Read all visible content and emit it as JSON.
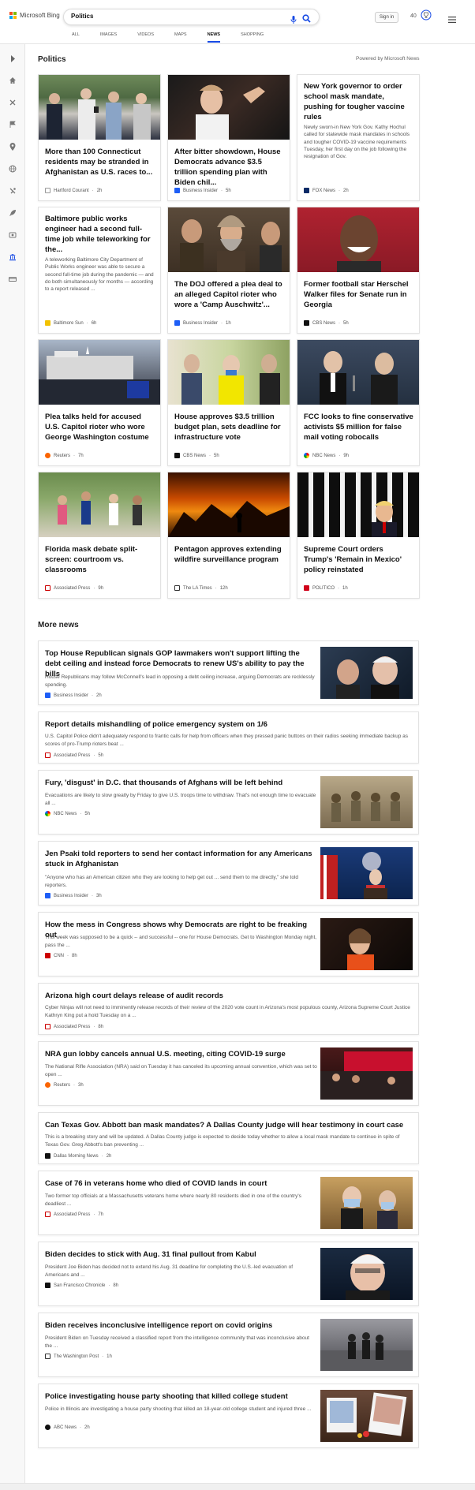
{
  "header": {
    "brand": "Microsoft Bing",
    "search_value": "Politics",
    "signin_label": "Sign in",
    "points": "40",
    "tabs": [
      "ALL",
      "IMAGES",
      "VIDEOS",
      "MAPS",
      "NEWS",
      "SHOPPING"
    ],
    "active_tab": "NEWS"
  },
  "sidebar": {
    "icons": [
      "chevron-right-icon",
      "home-icon",
      "sports-icon",
      "flag-icon",
      "location-pin-icon",
      "globe-icon",
      "science-icon",
      "rocket-icon",
      "entertainment-icon",
      "politics-icon",
      "money-icon"
    ]
  },
  "section": {
    "title": "Politics",
    "powered_by": "Powered by Microsoft News"
  },
  "cards": [
    {
      "headline": "More than 100 Connecticut residents may be stranded in Afghanistan as U.S. races to...",
      "source": "Hartford Courant",
      "time": "2h",
      "has_image": true
    },
    {
      "headline": "After bitter showdown, House Democrats advance $3.5 trillion spending plan with Biden chil...",
      "source": "Business Insider",
      "time": "5h",
      "has_image": true
    },
    {
      "headline": "New York governor to order school mask mandate, pushing for tougher vaccine rules",
      "snippet": "Newly sworn-in New York Gov. Kathy Hochul called for statewide mask mandates in schools and tougher COVID-19 vaccine requirements Tuesday, her first day on the job following the resignation of Gov.",
      "source": "FOX News",
      "time": "2h",
      "has_image": false
    },
    {
      "headline": "Baltimore public works engineer had a second full-time job while teleworking for the...",
      "snippet": "A teleworking Baltimore City Department of Public Works engineer was able to secure a second full-time job during the pandemic — and do both simultaneously for months — according to a report released ...",
      "source": "Baltimore Sun",
      "time": "6h",
      "has_image": false
    },
    {
      "headline": "The DOJ offered a plea deal to an alleged Capitol rioter who wore a 'Camp Auschwitz'...",
      "source": "Business Insider",
      "time": "1h",
      "has_image": true
    },
    {
      "headline": "Former football star Herschel Walker files for Senate run in Georgia",
      "source": "CBS News",
      "time": "5h",
      "has_image": true
    },
    {
      "headline": "Plea talks held for accused U.S. Capitol rioter who wore George Washington costume",
      "source": "Reuters",
      "time": "7h",
      "has_image": true
    },
    {
      "headline": "House approves $3.5 trillion budget plan, sets deadline for infrastructure vote",
      "source": "CBS News",
      "time": "5h",
      "has_image": true
    },
    {
      "headline": "FCC looks to fine conservative activists $5 million for false mail voting robocalls",
      "source": "NBC News",
      "time": "9h",
      "has_image": true
    },
    {
      "headline": "Florida mask debate split-screen: courtroom vs. classrooms",
      "source": "Associated Press",
      "time": "9h",
      "has_image": true
    },
    {
      "headline": "Pentagon approves extending wildfire surveillance program",
      "source": "The LA Times",
      "time": "12h",
      "has_image": true
    },
    {
      "headline": "Supreme Court orders Trump's 'Remain in Mexico' policy reinstated",
      "source": "POLITICO",
      "time": "1h",
      "has_image": true
    }
  ],
  "more_news": {
    "title": "More news",
    "items": [
      {
        "headline": "Top House Republican signals GOP lawmakers won't support lifting the debt ceiling and instead force Democrats to renew US's ability to pay the bills",
        "snippet": "House Republicans may follow McConnell's lead in opposing a debt ceiling increase, arguing Democrats are recklessly spending.",
        "source": "Business Insider",
        "time": "2h",
        "has_image": true
      },
      {
        "headline": "Report details mishandling of police emergency system on 1/6",
        "snippet": "U.S. Capitol Police didn't adequately respond to frantic calls for help from officers when they pressed panic buttons on their radios seeking immediate backup as scores of pro-Trump rioters beat ...",
        "source": "Associated Press",
        "time": "5h",
        "has_image": false
      },
      {
        "headline": "Fury, 'disgust' in D.C. that thousands of Afghans will be left behind",
        "snippet": "Evacuations are likely to slow greatly by Friday to give U.S. troops time to withdraw. That's not enough time to evacuate all ...",
        "source": "NBC News",
        "time": "5h",
        "has_image": true
      },
      {
        "headline": "Jen Psaki told reporters to send her contact information for any Americans stuck in Afghanistan",
        "snippet": "\"Anyone who has an American citizen who they are looking to help get out ... send them to me directly,\" she told reporters.",
        "source": "Business Insider",
        "time": "3h",
        "has_image": true
      },
      {
        "headline": "How the mess in Congress shows why Democrats are right to be freaking out",
        "snippet": "This week was supposed to be a quick -- and successful -- one for House Democrats. Get to Washington Monday night, pass the ...",
        "source": "CNN",
        "time": "8h",
        "has_image": true
      },
      {
        "headline": "Arizona high court delays release of audit records",
        "snippet": "Cyber Ninjas will not need to imminently release records of their review of the 2020 vote count in Arizona's most populous county, Arizona Supreme Court Justice Kathryn King put a hold Tuesday on a ...",
        "source": "Associated Press",
        "time": "8h",
        "has_image": false
      },
      {
        "headline": "NRA gun lobby cancels annual U.S. meeting, citing COVID-19 surge",
        "snippet": "The National Rifle Association (NRA) said on Tuesday it has canceled its upcoming annual convention, which was set to open ...",
        "source": "Reuters",
        "time": "3h",
        "has_image": true
      },
      {
        "headline": "Can Texas Gov. Abbott ban mask mandates? A Dallas County judge will hear testimony in court case",
        "snippet": "This is a breaking story and will be updated. A Dallas County judge is expected to decide today whether to allow a local mask mandate to continue in spite of Texas Gov. Greg Abbott's ban preventing ...",
        "source": "Dallas Morning News",
        "time": "2h",
        "has_image": false
      },
      {
        "headline": "Case of 76 in veterans home who died of COVID lands in court",
        "snippet": "Two former top officials at a Massachusetts veterans home where nearly 80 residents died in one of the country's deadliest ...",
        "source": "Associated Press",
        "time": "7h",
        "has_image": true
      },
      {
        "headline": "Biden decides to stick with Aug. 31 final pullout from Kabul",
        "snippet": "President Joe Biden has decided not to extend his Aug. 31 deadline for completing the U.S.-led evacuation of Americans and ...",
        "source": "San Francisco Chronicle",
        "time": "8h",
        "has_image": true
      },
      {
        "headline": "Biden receives inconclusive intelligence report on covid origins",
        "snippet": "President Biden on Tuesday received a classified report from the intelligence community that was inconclusive about the ...",
        "source": "The Washington Post",
        "time": "1h",
        "has_image": true
      },
      {
        "headline": "Police investigating house party shooting that killed college student",
        "snippet": "Police in Illinois are investigating a house party shooting that killed an 18-year-old college student and injured three ...",
        "source": "ABC News",
        "time": "2h",
        "has_image": true
      }
    ]
  },
  "colors": {
    "accent": "#174ae4",
    "bg": "#f5f5f5"
  }
}
